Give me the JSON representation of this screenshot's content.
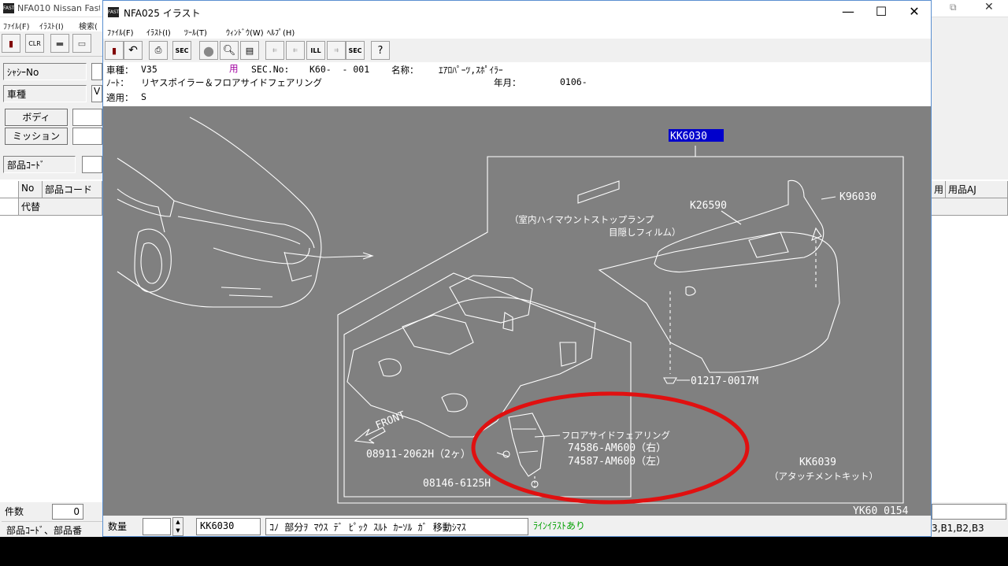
{
  "bg_window": {
    "title": "NFA010 Nissan Fast fo",
    "menu": [
      "ﾌｧｲﾙ(F)",
      "ｲﾗｽﾄ(I)",
      "検索("
    ],
    "fields": {
      "chassis_label": "ｼｬｼｰNo",
      "model_label": "車種",
      "model_value_fragment": "V",
      "body_button": "ボディ",
      "mission_button": "ミッション",
      "part_code_label": "部品ｺｰﾄﾞ"
    },
    "grid": {
      "col_no": "No",
      "col_part_code": "部品コード",
      "row2": "代替",
      "right_col1": "用",
      "right_col2": "用品AJ"
    },
    "bottom": {
      "count_label": "件数",
      "count_value": "0",
      "hint": "部品ｺｰﾄﾞ、部品番",
      "right_codes": "3,B1,B2,B3"
    }
  },
  "window": {
    "title": "NFA025 イラスト",
    "controls": {
      "minimize": "—",
      "maximize": "☐",
      "close": "✕"
    },
    "menu": [
      "ﾌｧｲﾙ(F)",
      "ｲﾗｽﾄ(I)",
      "ﾂｰﾙ(T)",
      "ｳｨﾝﾄﾞｳ(W)",
      "ﾍﾙﾌﾟ(H)"
    ],
    "toolbar": {
      "sec_label": "SEC",
      "ill_label": "ILL",
      "sec2_label": "SEC"
    },
    "info": {
      "model_label": "車種：",
      "model_value": "V35",
      "usage_mark": "用",
      "sec_label": "SEC.No:",
      "sec_value": "K60-  - 001",
      "name_label": "名称：",
      "name_value": "ｴｱﾛﾊﾟｰﾂ,ｽﾎﾟｲﾗｰ",
      "note_label": "ﾉｰﾄ：",
      "note_value": "リヤスポイラー＆フロアサイドフェアリング",
      "date_label": "年月：",
      "date_value": "0106-",
      "apply_label": "適用：",
      "apply_value": "S"
    },
    "illustration": {
      "kit_code_highlight": "KK6030",
      "part_k26590": "K26590",
      "part_k96030": "K96030",
      "film_line1": "（室内ハイマウントストップランプ",
      "film_line2": "目隠しフィルム）",
      "clip_part": "01217-0017M",
      "front_label": "FRONT",
      "fairing_name": "フロアサイドフェアリング",
      "fairing_right": "74586-AM600（右）",
      "fairing_left": "74587-AM600（左）",
      "bolt1": "08911-2062H（2ヶ）",
      "bolt2": "08146-6125H",
      "kit2_code": "KK6039",
      "kit2_name": "（アタッチメントキット）",
      "sheet_id": "YK60 0154"
    },
    "status": {
      "qty_label": "数量",
      "part_code": "KK6030",
      "message": "ｺﾉ 部分ｦ ﾏｳｽ ﾃﾞ ﾋﾟｯｸ ｽﾙﾄ ｶｰｿﾙ ｶﾞ 移動ｼﾏｽ",
      "line_illust": "ﾗｲﾝｲﾗｽﾄあり"
    }
  },
  "colors": {
    "canvas_bg": "#808080",
    "highlight_bg": "#0000cc",
    "annotation_circle": "#e01010",
    "status_green": "#00a000"
  }
}
